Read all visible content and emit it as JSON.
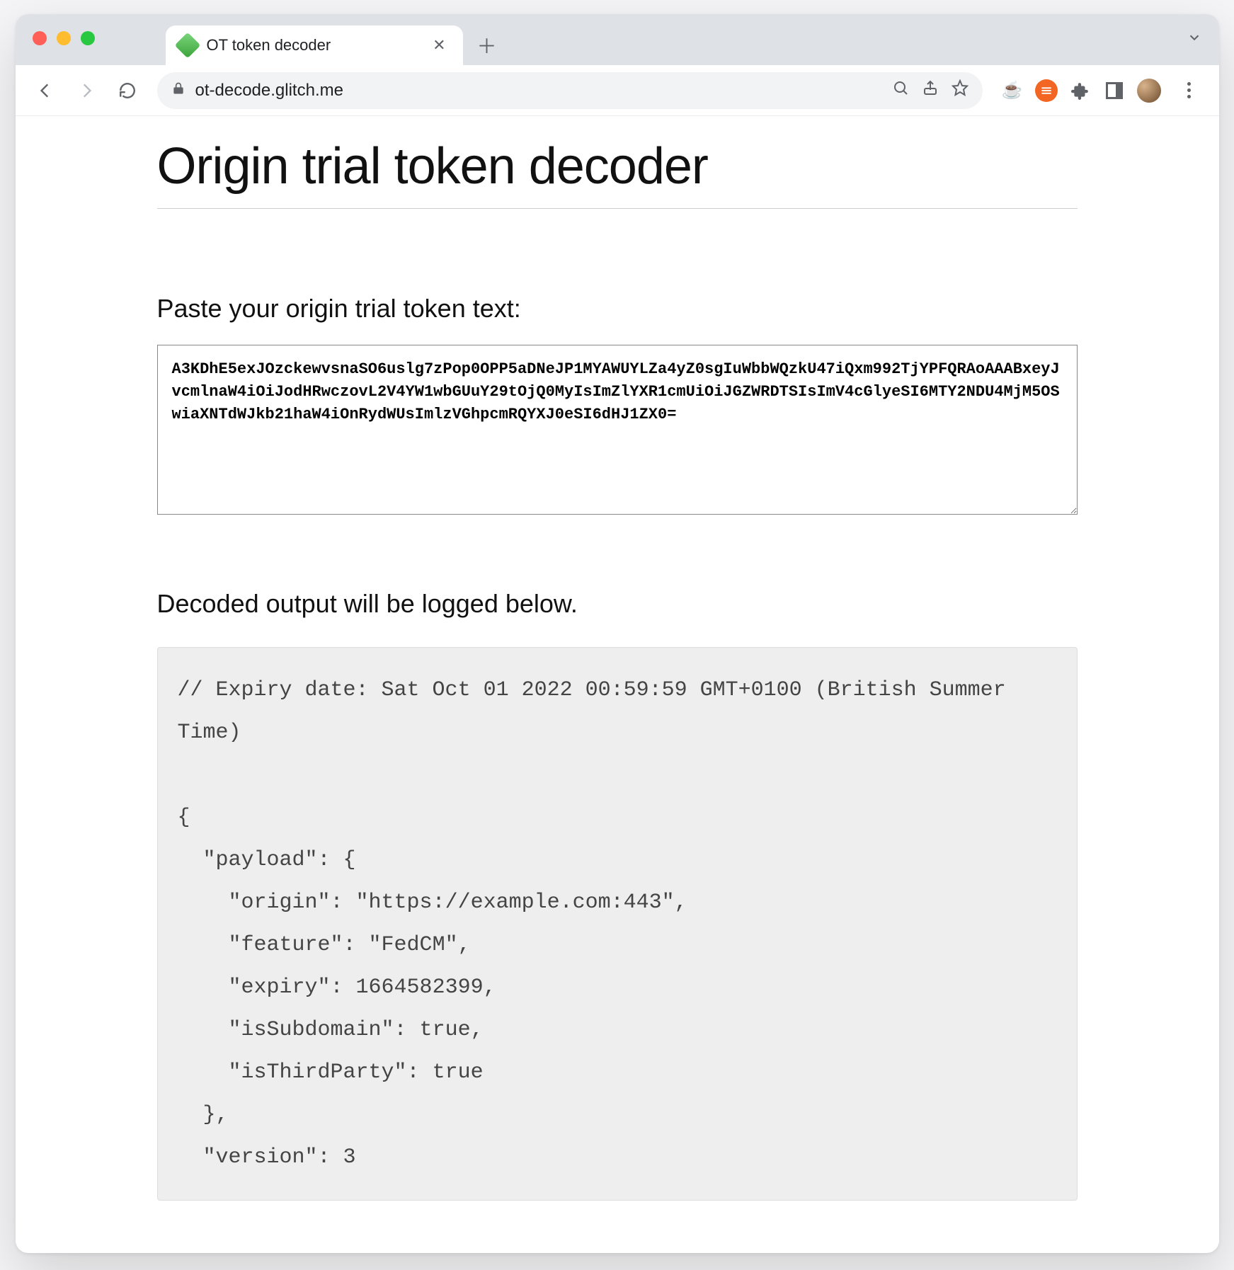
{
  "browser": {
    "tab": {
      "title": "OT token decoder"
    },
    "url": "ot-decode.glitch.me"
  },
  "page": {
    "title": "Origin trial token decoder",
    "paste_label": "Paste your origin trial token text:",
    "token_value": "A3KDhE5exJOzckewvsnaSO6uslg7zPop0OPP5aDNeJP1MYAWUYLZa4yZ0sgIuWbbWQzkU47iQxm992TjYPFQRAoAAABxeyJvcmlnaW4iOiJodHRwczovL2V4YW1wbGUuY29tOjQ0MyIsImZlYXR1cmUiOiJGZWRDTSIsImV4cGlyeSI6MTY2NDU4MjM5OSwiaXNTdWJkb21haW4iOnRydWUsImlzVGhpcmRQYXJ0eSI6dHJ1ZX0=",
    "output_label": "Decoded output will be logged below.",
    "output_text": "// Expiry date: Sat Oct 01 2022 00:59:59 GMT+0100 (British Summer Time)\n\n{\n  \"payload\": {\n    \"origin\": \"https://example.com:443\",\n    \"feature\": \"FedCM\",\n    \"expiry\": 1664582399,\n    \"isSubdomain\": true,\n    \"isThirdParty\": true\n  },\n  \"version\": 3"
  }
}
